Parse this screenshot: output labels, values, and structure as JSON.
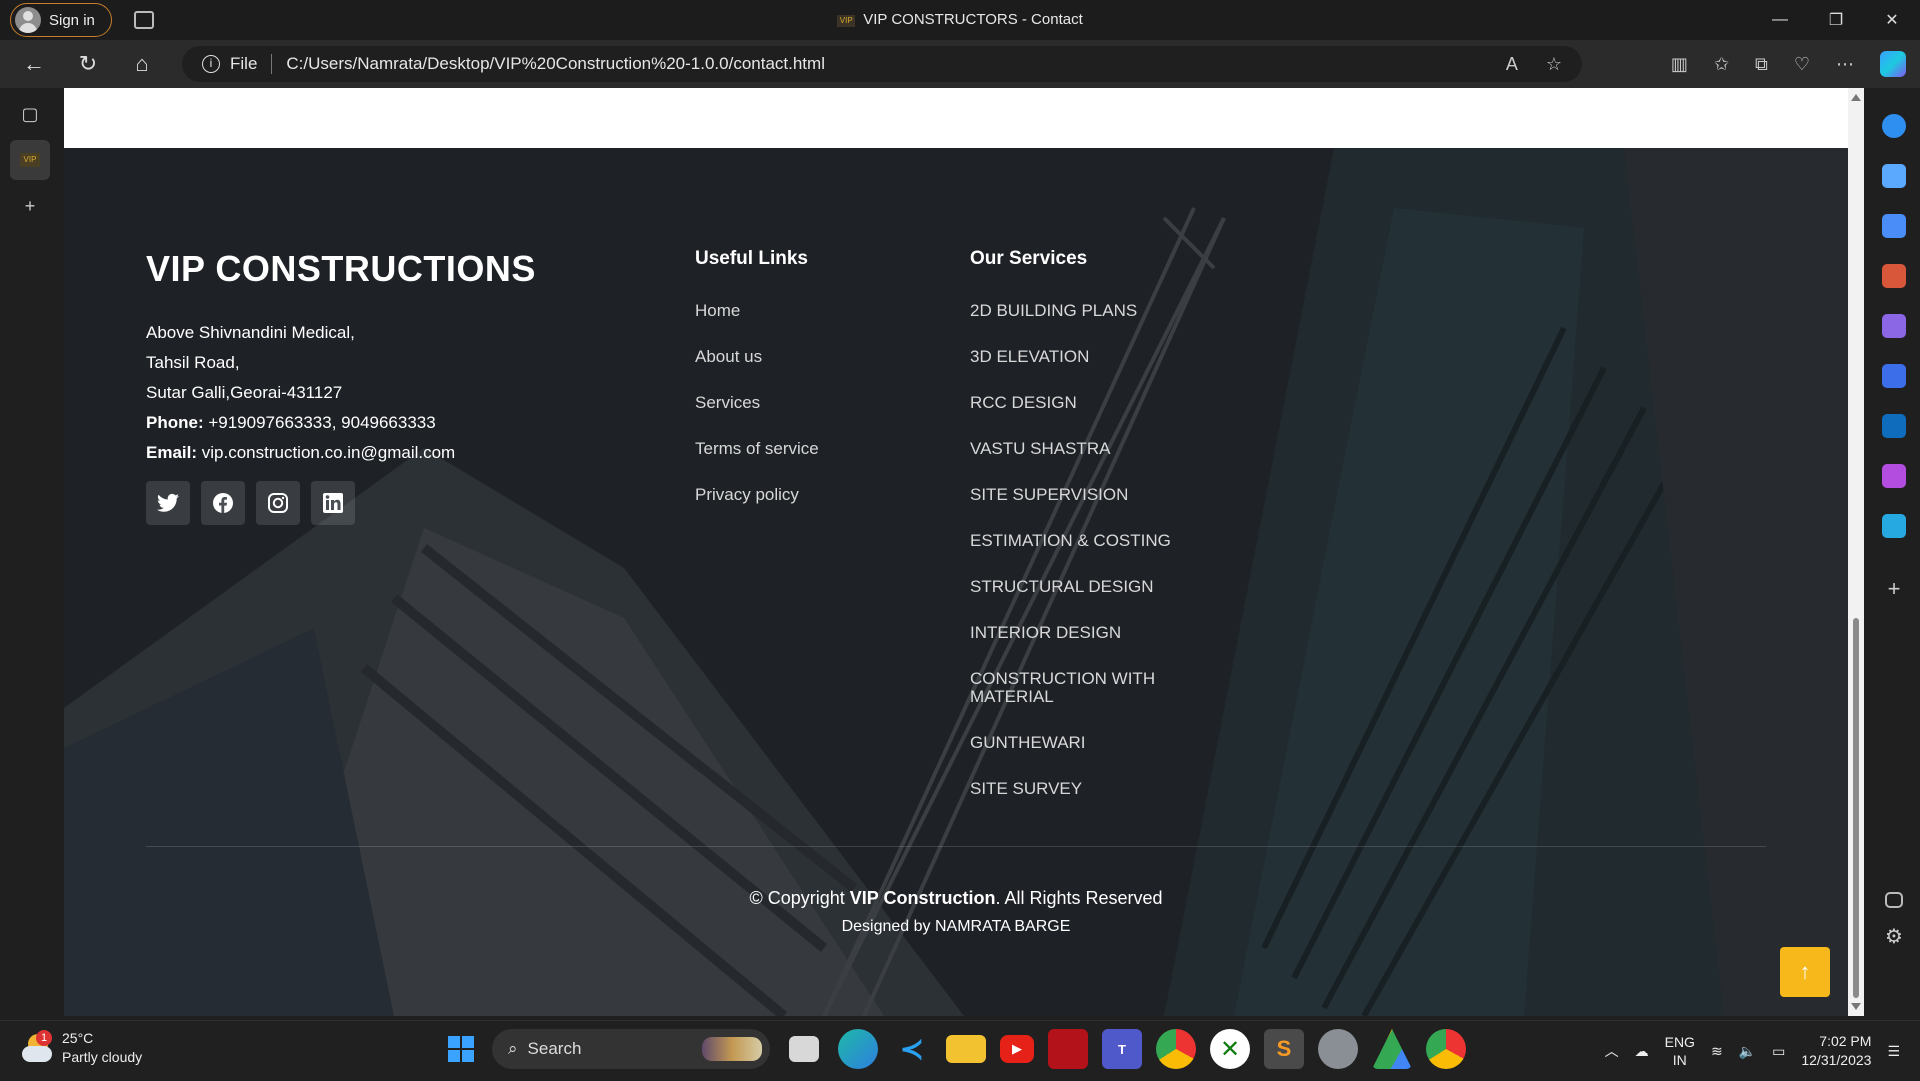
{
  "browser": {
    "signin_label": "Sign in",
    "tab_title": "VIP CONSTRUCTORS - Contact",
    "favicon_text": "VIP",
    "address_scheme": "File",
    "address_url": "C:/Users/Namrata/Desktop/VIP%20Construction%20-1.0.0/contact.html"
  },
  "footer": {
    "brand": "VIP CONSTRUCTIONS",
    "address_lines": [
      "Above Shivnandini Medical,",
      "Tahsil Road,",
      "Sutar Galli,Georai-431127"
    ],
    "phone_label": "Phone:",
    "phone_value": " +919097663333, 9049663333",
    "email_label": "Email:",
    "email_value": " vip.construction.co.in@gmail.com",
    "socials": [
      "twitter-icon",
      "facebook-icon",
      "instagram-icon",
      "linkedin-icon"
    ],
    "useful_links_title": "Useful Links",
    "useful_links": [
      "Home",
      "About us",
      "Services",
      "Terms of service",
      "Privacy policy"
    ],
    "services_title": "Our Services",
    "services": [
      "2D BUILDING PLANS",
      "3D ELEVATION",
      "RCC DESIGN",
      "VASTU SHASTRA",
      "SITE SUPERVISION",
      "ESTIMATION & COSTING",
      "STRUCTURAL DESIGN",
      "INTERIOR DESIGN",
      "CONSTRUCTION WITH MATERIAL",
      "GUNTHEWARI",
      "SITE SURVEY"
    ],
    "copyright_prefix": "© Copyright ",
    "copyright_brand": "VIP Construction",
    "copyright_suffix": ". All Rights Reserved",
    "designed_by": "Designed by NAMRATA BARGE",
    "back_to_top": "↑"
  },
  "taskbar": {
    "weather_temp": "25°C",
    "weather_desc": "Partly cloudy",
    "weather_badge": "1",
    "search_label": "Search",
    "lang_top": "ENG",
    "lang_bottom": "IN",
    "time": "7:02 PM",
    "date": "12/31/2023"
  },
  "colors": {
    "accent": "#f6b81a",
    "footer_bg": "#2b2f34"
  }
}
